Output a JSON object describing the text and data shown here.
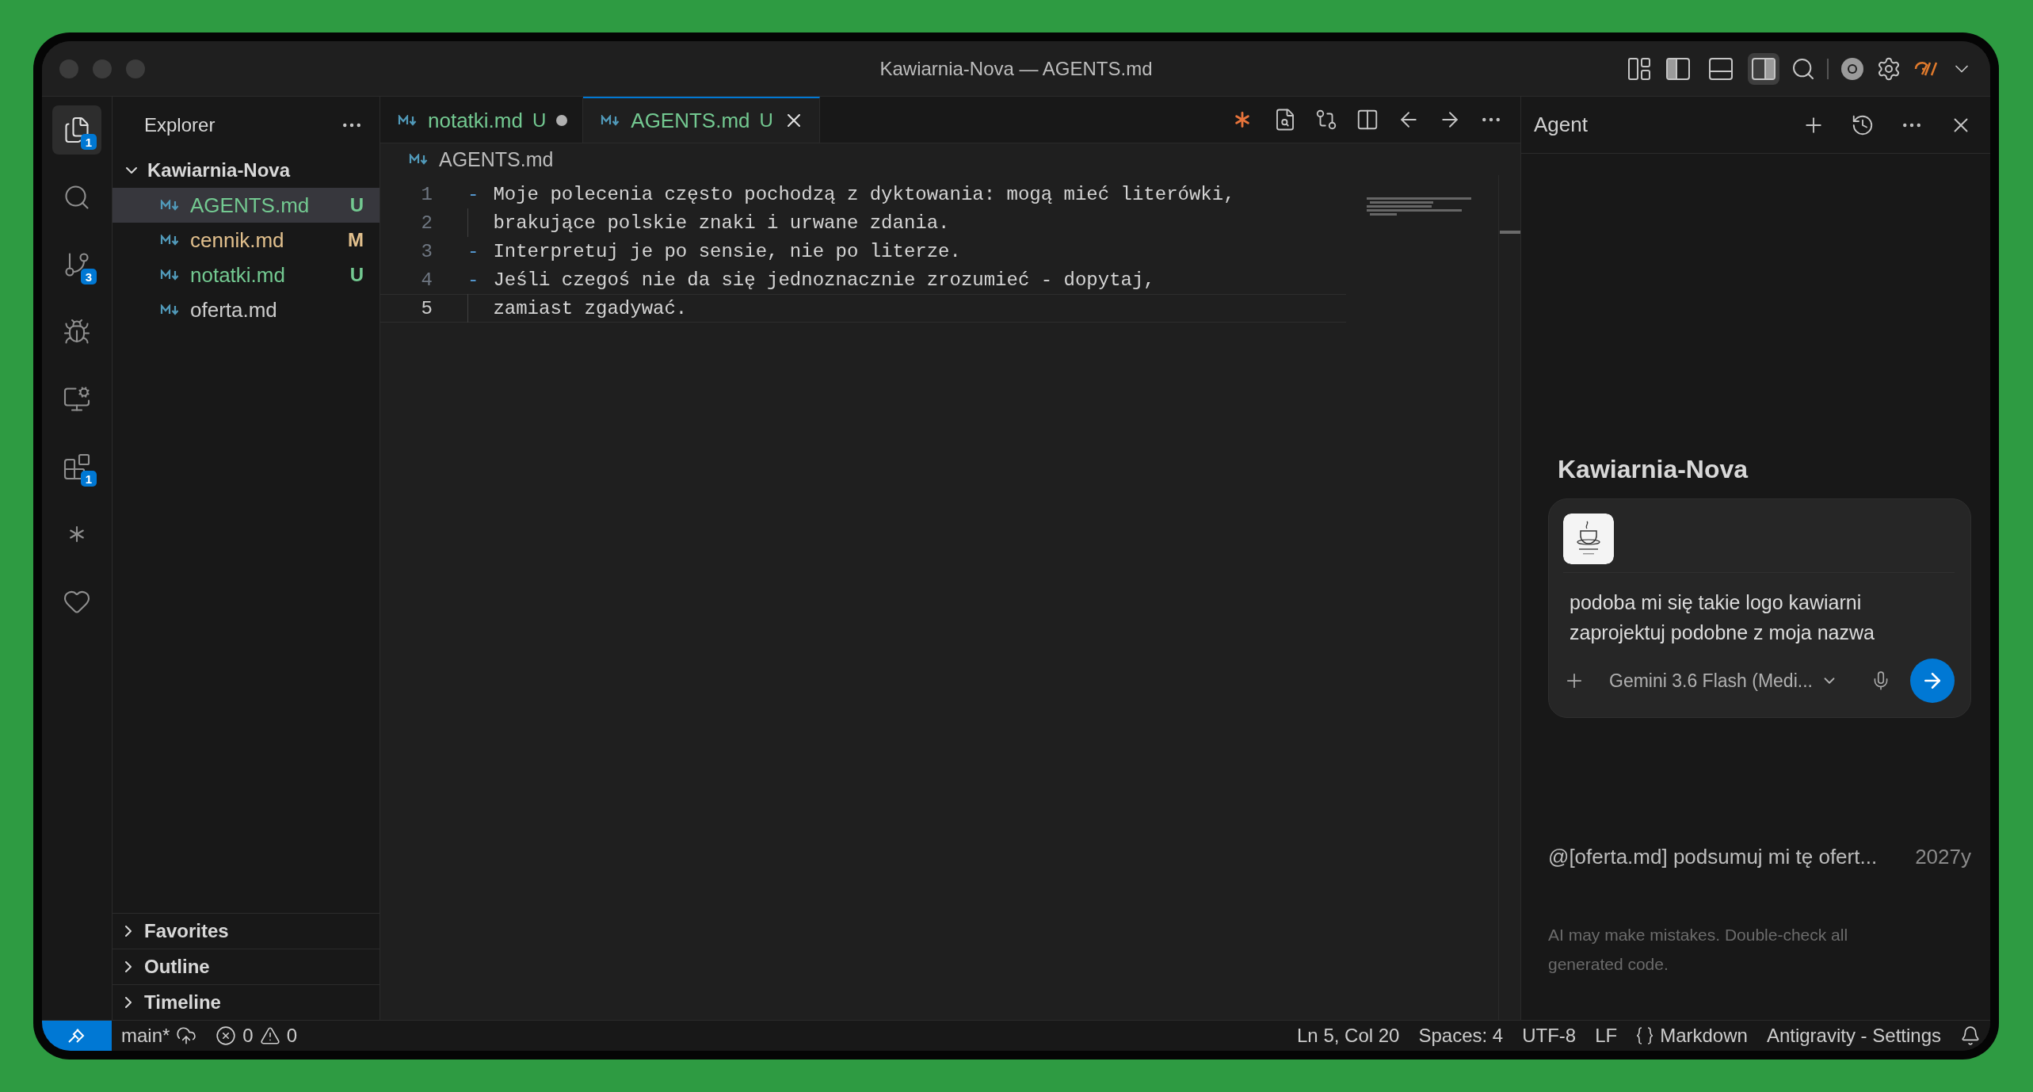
{
  "window": {
    "title": "Kawiarnia-Nova — AGENTS.md"
  },
  "layout_toggles": [
    {
      "kind": "primary_sidebar",
      "on": true,
      "selected": false
    },
    {
      "kind": "panel",
      "on": false,
      "selected": false
    },
    {
      "kind": "secondary_sidebar",
      "on": true,
      "selected": true
    }
  ],
  "activity_bar": [
    {
      "kind": "explorer",
      "selected": true,
      "badge": "1"
    },
    {
      "kind": "search",
      "selected": false
    },
    {
      "kind": "source_control",
      "selected": false,
      "badge": "3"
    },
    {
      "kind": "run_debug",
      "selected": false
    },
    {
      "kind": "remote",
      "selected": false
    },
    {
      "kind": "extensions",
      "selected": false,
      "badge": "1"
    },
    {
      "kind": "agent",
      "selected": false
    },
    {
      "kind": "favorites",
      "selected": false
    }
  ],
  "explorer": {
    "title": "Explorer",
    "folder": {
      "name": "Kawiarnia-Nova",
      "expanded": true,
      "children": [
        {
          "name": "AGENTS.md",
          "status": "U",
          "color": "#73c991",
          "selected": true
        },
        {
          "name": "cennik.md",
          "status": "M",
          "color": "#e2c08d",
          "selected": false
        },
        {
          "name": "notatki.md",
          "status": "U",
          "color": "#73c991",
          "selected": false
        },
        {
          "name": "oferta.md",
          "color": "#cccccc",
          "selected": false
        }
      ]
    },
    "sections": [
      {
        "label": "Favorites",
        "expanded": false
      },
      {
        "label": "Outline",
        "expanded": false
      },
      {
        "label": "Timeline",
        "expanded": false
      }
    ]
  },
  "tabs": [
    {
      "label": "notatki.md",
      "status": "U",
      "selected": false,
      "dirty": true
    },
    {
      "label": "AGENTS.md",
      "status": "U",
      "selected": true,
      "dirty": false
    }
  ],
  "breadcrumb": "AGENTS.md",
  "editor": {
    "lines": [
      {
        "number": "1",
        "kind": "bullet",
        "marker": "-",
        "text": "Moje polecenia często pochodzą z dyktowania: mogą mieć literówki,",
        "current": false
      },
      {
        "number": "2",
        "kind": "continuation",
        "text": "brakujące polskie znaki i urwane zdania.",
        "current": false
      },
      {
        "number": "3",
        "kind": "bullet",
        "marker": "-",
        "text": "Interpretuj je po sensie, nie po literze.",
        "current": false
      },
      {
        "number": "4",
        "kind": "bullet",
        "marker": "-",
        "text": "Jeśli czegoś nie da się jednoznacznie zrozumieć - dopytaj,",
        "current": false
      },
      {
        "number": "5",
        "kind": "continuation",
        "text": "zamiast zgadywać.",
        "current": true
      }
    ]
  },
  "agent": {
    "title": "Agent",
    "workspace": "Kawiarnia-Nova",
    "prompt": {
      "text": "podoba mi się takie logo kawiarni\nzaprojektuj podobne z moja nazwa",
      "model": "Gemini 3.6 Flash (Medi..."
    },
    "history": [
      {
        "text": "@[oferta.md] podsumuj mi tę ofert...",
        "age": "2027y"
      }
    ],
    "disclaimer": "AI may make mistakes. Double-check all\ngenerated code."
  },
  "status_bar": {
    "branch": "main*",
    "errors": "0",
    "warnings": "0",
    "position": "Ln 5, Col 20",
    "indent": "Spaces: 4",
    "encoding": "UTF-8",
    "eol": "LF",
    "language": "Markdown",
    "settings": "Antigravity - Settings"
  }
}
